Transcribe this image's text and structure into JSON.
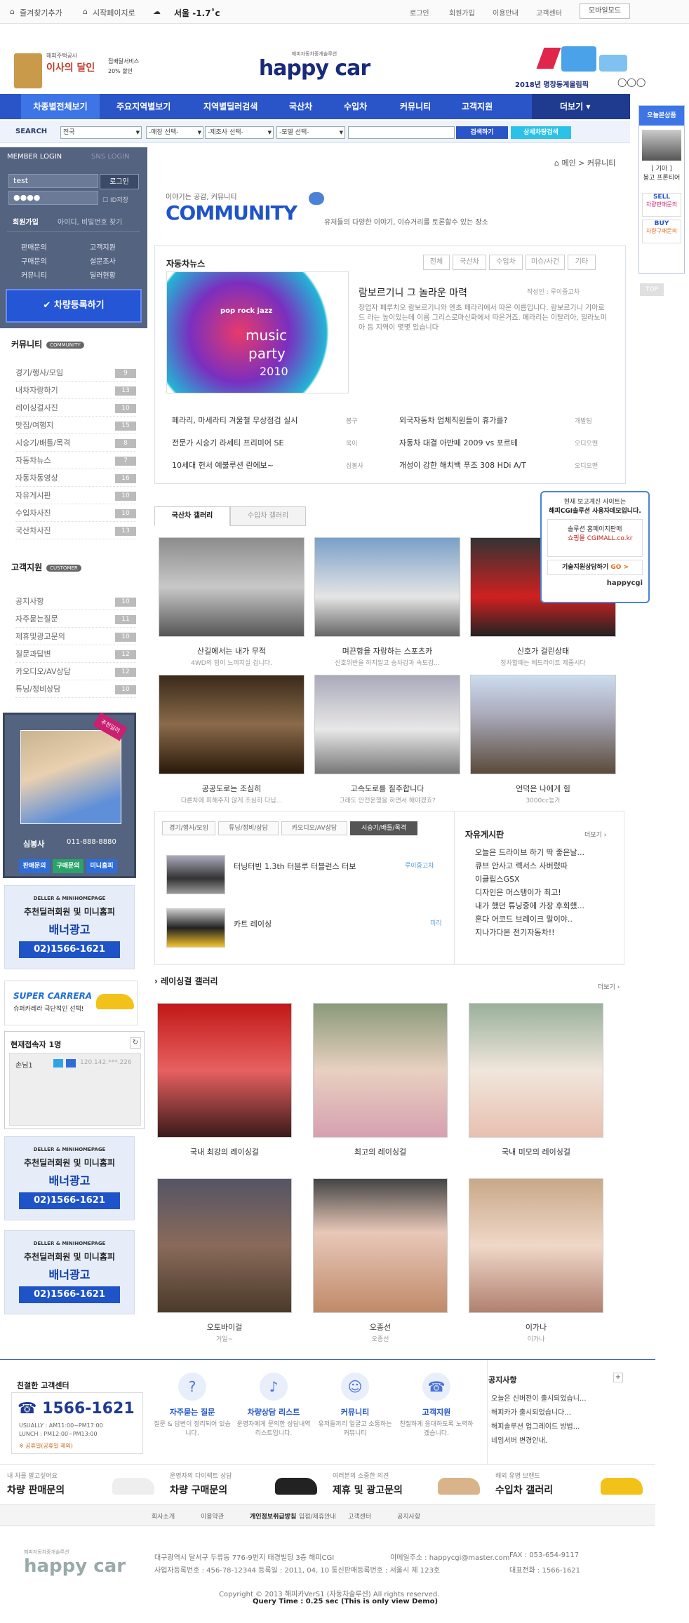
{
  "topbar": {
    "bookmark": "즐겨찾기추가",
    "home": "시작페이지로",
    "weather": "서울 -1.7˚c",
    "links": [
      "로그인",
      "회원가입",
      "이용안내",
      "고객센터"
    ],
    "mobile": "모바일모드"
  },
  "header": {
    "logo_small": "해피자동차중개솔루션",
    "logo": "happy car",
    "ad_left_1": "해피주택공사",
    "ad_left_2": "이사의 달인",
    "ad_left_3": "집배달서비스",
    "ad_left_4": "20% 할인",
    "ad_right": "2018년 평창동계올림픽"
  },
  "nav": {
    "items": [
      "차종별전체보기",
      "주요지역별보기",
      "지역별딜러검색",
      "국산차",
      "수입차",
      "커뮤니티",
      "고객지원"
    ],
    "more": "더보기"
  },
  "search": {
    "label": "SEARCH",
    "region": "전국",
    "sel1": "-매장 선택-",
    "sel2": "-제조사 선택-",
    "sel3": "-모델 선택-",
    "btn1": "검색하기",
    "btn2": "상세차량검색"
  },
  "login": {
    "tab1": "MEMBER LOGIN",
    "tab2": "SNS LOGIN",
    "id": "test",
    "pw": "●●●●",
    "btn": "로그인",
    "save": "ID저장",
    "join": "회원가입",
    "find": "아이디, 비밀번호 찾기",
    "menu": [
      "판매문의",
      "고객지원",
      "구매문의",
      "설문조사",
      "커뮤니티",
      "딜러현황"
    ],
    "register": "차량등록하기"
  },
  "community_side": {
    "title": "커뮤니티",
    "badge": "COMMUNITY",
    "items": [
      {
        "label": "경기/행사/모임",
        "cnt": "9"
      },
      {
        "label": "내차자랑하기",
        "cnt": "13"
      },
      {
        "label": "레이싱걸사진",
        "cnt": "10"
      },
      {
        "label": "맛집/여행지",
        "cnt": "15"
      },
      {
        "label": "시승기/배틀/목격",
        "cnt": "8"
      },
      {
        "label": "자동차뉴스",
        "cnt": "7"
      },
      {
        "label": "자동차동영상",
        "cnt": "16"
      },
      {
        "label": "자유게시판",
        "cnt": "10"
      },
      {
        "label": "수입차사진",
        "cnt": "10"
      },
      {
        "label": "국산차사진",
        "cnt": "13"
      }
    ]
  },
  "customer_side": {
    "title": "고객지원",
    "badge": "CUSTOMER",
    "items": [
      {
        "label": "공지사항",
        "cnt": "10"
      },
      {
        "label": "자주묻는질문",
        "cnt": "11"
      },
      {
        "label": "제휴및광고문의",
        "cnt": "10"
      },
      {
        "label": "질문과답변",
        "cnt": "12"
      },
      {
        "label": "카오디오/AV상담",
        "cnt": "12"
      },
      {
        "label": "튜닝/정비상담",
        "cnt": "10"
      }
    ]
  },
  "profile": {
    "tag": "추천딜러",
    "name": "심봉사",
    "phone": "011-888-8880",
    "btns": [
      "판매문의",
      "구매문의",
      "미니홈피"
    ]
  },
  "banner": {
    "b1": "DELLER & MINIHOMEPAGE",
    "b2": "추천딜러회원 및 미니홈피",
    "b3": "배너광고",
    "b4": "02)1566-1621"
  },
  "carrera": {
    "title": "SUPER CARRERA",
    "sub": "슈퍼카레라 극단적인 선택!"
  },
  "visitor": {
    "title": "현재접속자",
    "count": "1명",
    "user": "손님1",
    "ip": "120.142.***.226"
  },
  "main": {
    "breadcrumb": "메인  >  커뮤니티",
    "comm_tag": "이야기는 공감, 커뮤니티",
    "comm_title": "COMMUNITY",
    "comm_sub": "유저들의 다양한 이야기, 이슈거리를 토론할수 있는 장소"
  },
  "news": {
    "title": "자동차뉴스",
    "tabs": [
      "전체",
      "국산차",
      "수입차",
      "미슈/사건",
      "기타"
    ],
    "img1": "pop rock jazz",
    "img2": "music",
    "img3": "party",
    "img4": "2010",
    "head": "람보르기니 그 놀라운 마력",
    "author": "작성인 : 루이중고차",
    "body": "창업자 페루치오 람보르기니와 엔초 페라리에서 따온 이름입니다. 람보르기니 기아로드 라는 높이있는데 이름 그리스로마신화에서 따온거죠. 페라리는 이탈리아, 밀라노미아 등 지역이 몇몇 있습니다",
    "list": [
      {
        "t": "페라리, 마세라티 겨울철 무상점검 실시",
        "a": "봉구"
      },
      {
        "t": "외국자동차 업체직원들이 휴가를?",
        "a": "개발팀"
      },
      {
        "t": "전문가 시승기 라세티 프리미어 SE",
        "a": "욱이"
      },
      {
        "t": "자동차 대결 아반떼 2009 vs 포르테",
        "a": "오디오맨"
      },
      {
        "t": "10세대 헌서 예불루션 란에보~",
        "a": "심봉사"
      },
      {
        "t": "개성이 강한 해치백 푸조 308 HDi A/T",
        "a": "오디오맨"
      }
    ]
  },
  "gallery": {
    "tabs": [
      "국산차 갤러리",
      "수입차 갤러리"
    ],
    "items": [
      {
        "c": "산길에서는 내가 무적",
        "s": "4WD의 힘이 느껴지실 겁니다."
      },
      {
        "c": "며끈함을 자랑하는 스포츠카",
        "s": "신호위반을 하지말고 승차감과 속도감..."
      },
      {
        "c": "신호가 걸린상태",
        "s": "정차할때는 헤드라이트 제줍시다"
      },
      {
        "c": "공공도로는 조심히",
        "s": "다른차에 피해주지 않게 조심히 다닙..."
      },
      {
        "c": "고속도로를 질주합니다",
        "s": "그래도 안전운행을 하면서 해야겠죠?"
      },
      {
        "c": "언덕은 나에게 힘",
        "s": "3000cc능가"
      }
    ]
  },
  "board": {
    "tabs": [
      "경기/행사/모임",
      "튜닝/정비/상담",
      "카오디오/AV상담",
      "시승기/배틀/목격"
    ],
    "posts": [
      {
        "t": "터닝터빈 1.3th 터뷴루 터블런스 터보",
        "a": "루이중고차"
      },
      {
        "t": "카트 레이싱",
        "a": "미리"
      }
    ],
    "free_title": "자유게시판",
    "more": "더보기",
    "free": [
      "오늘은 드라이브 하기 딱 좋은날...",
      "큐브 안사고 렉서스 사버렸따",
      "이클립스GSX",
      "디자인은 머스탱이가 최고!",
      "내가 했던 튜닝중에 가장 후회했...",
      "혼다 어코드 브레이크 말이야..",
      "지나가다본 전기자동차!!"
    ]
  },
  "racing": {
    "title": "레이싱걸 갤러리",
    "more": "더보기",
    "items": [
      {
        "c": "국내 최강의 레이싱걸",
        "s": ""
      },
      {
        "c": "최고의 레이싱걸",
        "s": ""
      },
      {
        "c": "국내 미모의 레이싱걸",
        "s": ""
      },
      {
        "c": "오토바이걸",
        "s": "거일~"
      },
      {
        "c": "오종선",
        "s": "오종선"
      },
      {
        "c": "이가나",
        "s": "이가나"
      }
    ]
  },
  "today": {
    "title": "오늘본상품",
    "car": "[ 기아 ]",
    "car2": "봉고 프론티어",
    "sell": "SELL",
    "sell_t": "차량판매문의",
    "buy": "BUY",
    "buy_t": "차량구매문의",
    "top": "TOP"
  },
  "notice": {
    "l1": "현재 보고계신 사이트는",
    "l2": "해피CGI솔루션 사용자데모입니다.",
    "l3": "솔루션 홈페이지판매",
    "l4": "쇼핑몰 CGIMALL.co.kr",
    "l5": "기술지원상담하기",
    "go": "GO >",
    "brand": "happycgi"
  },
  "footer": {
    "cs_title": "친절한 고객센터",
    "phone": "1566-1621",
    "hours1": "USUALLY : AM11:00~PM17:00",
    "hours2": "LUNCH : PM12:00~PM13:00",
    "holiday": "※ 공휴일(공휴일 제외)",
    "svc": [
      {
        "ic": "?",
        "t": "자주묻는 질문",
        "d": "질문 & 답변이 정리되어 있습니다."
      },
      {
        "ic": "♪",
        "t": "차량상담 리스트",
        "d": "운영자에게 문의한 상담내역 리스트입니다."
      },
      {
        "ic": "☺",
        "t": "커뮤니티",
        "d": "유저들끼리 얼굴고 소통하는 커뮤니티"
      },
      {
        "ic": "☎",
        "t": "고객지원",
        "d": "친절하게 응대하도록 노력하겠습니다."
      }
    ],
    "notice_title": "공지사항",
    "notices": [
      "오늘은 신버전이 출시되었습니...",
      "해피카가 출시되었습니다...",
      "해피솔루션 업그레이드 방법...",
      "네임서버 변경안내."
    ],
    "ads": [
      {
        "s": "내 차를 팔고싶어요",
        "m": "차량 판매문의"
      },
      {
        "s": "운영자의 다이렉트 상담",
        "m": "차량 구매문의"
      },
      {
        "s": "여러분의 소중한 의견",
        "m": "제휴 및 광고문의"
      },
      {
        "s": "해외 유명 브랜드",
        "m": "수입차 갤러리"
      }
    ],
    "links": [
      "회사소개",
      "이용약관",
      "개인정보취급방침",
      "입점/제휴안내",
      "고객센터",
      "공지사항"
    ],
    "info1": "대구광역시 달서구 두류동 776-9번지 태경빌딩 3층 해피CGI",
    "info2": "사업자등록번호 : 456-78-12344     등록일 : 2011, 04, 10     통신판매등록번호 : 서울시 제 123호",
    "email": "이메일주소 : happycgi@master.com",
    "fax": "FAX : 053-654-9117",
    "rep": "대표전화 : 1566-1621",
    "copy": "Copyright © 2013 해피카VerS1 (자동차솔루션) All rights reserved.",
    "query": "Query Time : 0.25 sec (This is only view Demo)"
  }
}
